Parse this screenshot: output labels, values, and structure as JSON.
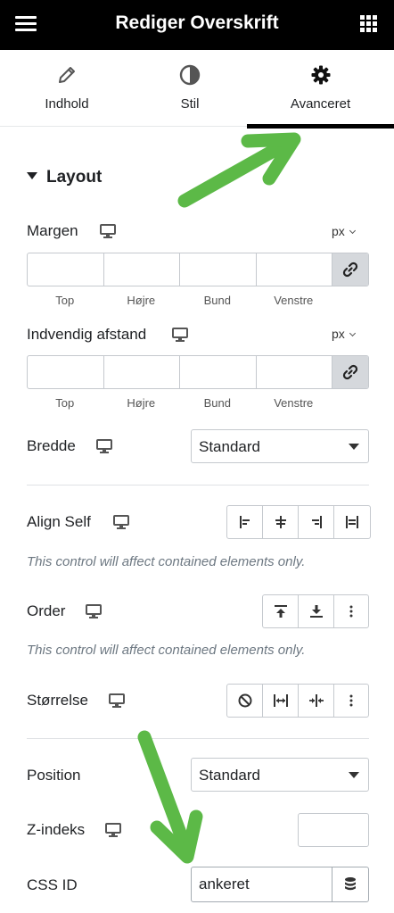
{
  "topbar": {
    "title": "Rediger Overskrift",
    "menu_icon": "hamburger-icon",
    "grid_icon": "apps-grid-icon"
  },
  "tabs": [
    {
      "label": "Indhold",
      "icon": "pencil-icon"
    },
    {
      "label": "Stil",
      "icon": "half-circle-icon"
    },
    {
      "label": "Avanceret",
      "icon": "gear-icon",
      "active": true
    }
  ],
  "section": {
    "title": "Layout"
  },
  "margin": {
    "label": "Margen",
    "unit": "px",
    "sides": [
      "Top",
      "Højre",
      "Bund",
      "Venstre"
    ]
  },
  "padding": {
    "label": "Indvendig afstand",
    "unit": "px",
    "sides": [
      "Top",
      "Højre",
      "Bund",
      "Venstre"
    ]
  },
  "width": {
    "label": "Bredde",
    "value": "Standard"
  },
  "align_self": {
    "label": "Align Self",
    "note": "This control will affect contained elements only."
  },
  "order": {
    "label": "Order",
    "note": "This control will affect contained elements only."
  },
  "size": {
    "label": "Størrelse"
  },
  "position": {
    "label": "Position",
    "value": "Standard"
  },
  "zindex": {
    "label": "Z-indeks",
    "value": ""
  },
  "css_id": {
    "label": "CSS ID",
    "value": "ankeret"
  },
  "colors": {
    "accent_arrow": "#5cb947",
    "topbar": "#000000",
    "border": "#c5c9ce"
  }
}
